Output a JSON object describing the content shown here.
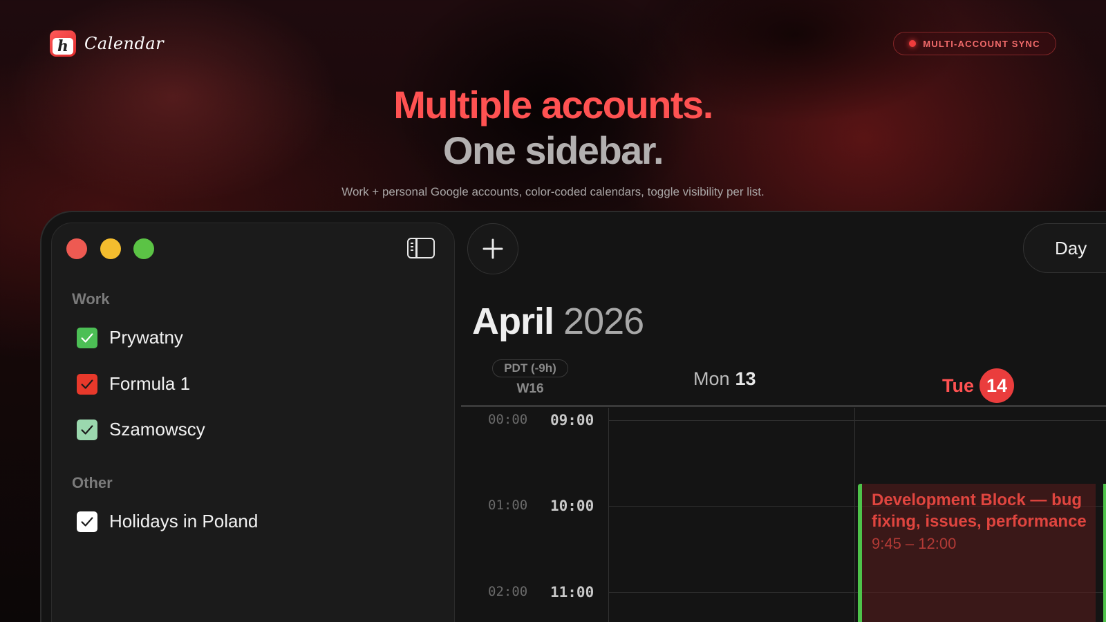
{
  "brand": {
    "name": "Calendar",
    "logo_glyph": "h",
    "icon": "calendar-app-logo-icon"
  },
  "badge": {
    "text": "MULTI-ACCOUNT SYNC",
    "dot_color": "#f03c3c"
  },
  "hero": {
    "line1": "Multiple accounts.",
    "line2": "One sidebar.",
    "subtitle": "Work + personal Google accounts, color-coded calendars, toggle visibility per list."
  },
  "sidebar": {
    "groups": [
      {
        "label": "Work",
        "calendars": [
          {
            "label": "Prywatny",
            "checked": true,
            "color": "#4cbf55"
          },
          {
            "label": "Formula 1",
            "checked": true,
            "color": "#e8392b"
          },
          {
            "label": "Szamowscy",
            "checked": true,
            "color": "#9bd8ae"
          }
        ]
      },
      {
        "label": "Other",
        "calendars": [
          {
            "label": "Holidays in Poland",
            "checked": true,
            "color": "#ffffff"
          }
        ]
      }
    ]
  },
  "toolbar": {
    "add_label": "+",
    "view_label": "Day"
  },
  "calendar": {
    "month": "April",
    "year": "2026",
    "timezone": "PDT (-9h)",
    "week": "W16",
    "days": [
      {
        "name": "Mon",
        "number": "13",
        "today": false
      },
      {
        "name": "Tue",
        "number": "14",
        "today": true
      }
    ],
    "times": [
      {
        "alt": "00:00",
        "main": "09:00"
      },
      {
        "alt": "01:00",
        "main": "10:00"
      },
      {
        "alt": "02:00",
        "main": "11:00"
      }
    ],
    "event": {
      "title": "Development Block — bug fixing, issues, performance",
      "time": "9:45 – 12:00",
      "accent": "#4ec34a"
    }
  },
  "colors": {
    "accent": "#ff5252",
    "today": "#ea3d3d"
  }
}
